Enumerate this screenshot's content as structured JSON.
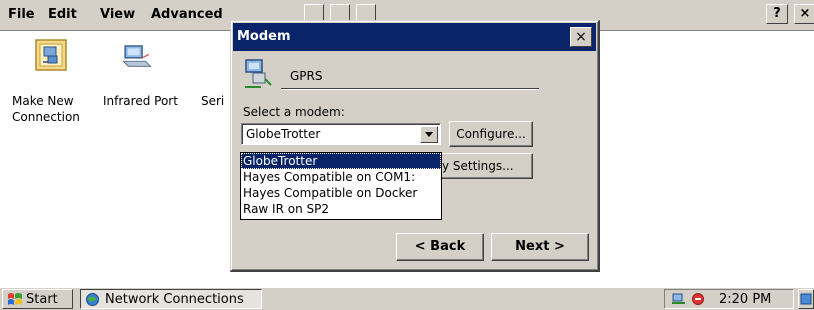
{
  "menubar": {
    "items": [
      "File",
      "Edit",
      "View",
      "Advanced"
    ],
    "help_label": "?",
    "close_label": "×"
  },
  "icons": [
    {
      "label_line1": "Make New",
      "label_line2": "Connection"
    },
    {
      "label_line1": "Infrared Port",
      "label_line2": ""
    },
    {
      "label_line1": "Seri",
      "label_line2": ""
    }
  ],
  "dialog": {
    "title": "Modem",
    "close_label": "×",
    "connection_name": "GPRS",
    "select_label": "Select a modem:",
    "selected_modem": "GlobeTrotter",
    "configure_label": "Configure...",
    "settings_label": "y Settings...",
    "back_label": "< Back",
    "next_label": "Next >"
  },
  "dropdown": {
    "options": [
      "GlobeTrotter",
      "Hayes Compatible on COM1:",
      "Hayes Compatible on Docker",
      "Raw IR on SP2"
    ],
    "selected_index": 0
  },
  "taskbar": {
    "start_label": "Start",
    "task_label": "Network Connections",
    "clock": "2:20 PM"
  }
}
